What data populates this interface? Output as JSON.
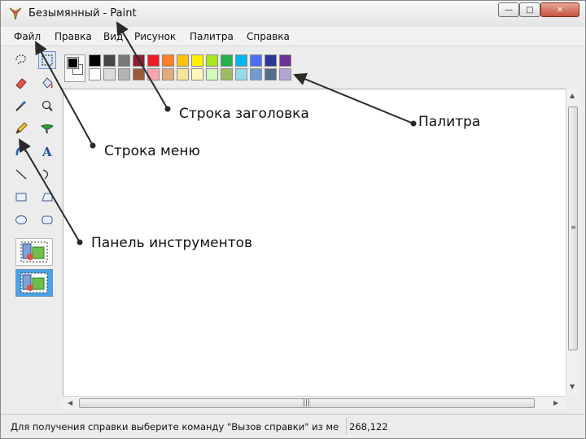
{
  "window": {
    "title": "Безымянный - Paint",
    "controls": {
      "minimize": "—",
      "maximize": "□",
      "close": "✕"
    }
  },
  "menu": {
    "items": [
      "Файл",
      "Правка",
      "Вид",
      "Рисунок",
      "Палитра",
      "Справка"
    ]
  },
  "tools": [
    "free-select-icon",
    "rect-select-icon",
    "eraser-icon",
    "fill-icon",
    "eyedropper-icon",
    "magnifier-icon",
    "pencil-icon",
    "brush-icon",
    "airbrush-icon",
    "text-icon",
    "line-icon",
    "curve-icon",
    "rectangle-icon",
    "polygon-icon",
    "ellipse-icon",
    "rounded-rect-icon"
  ],
  "palette": {
    "foreground": "#000000",
    "background": "#ffffff",
    "row1": [
      "#000000",
      "#464646",
      "#787878",
      "#8c1e2d",
      "#ec1c24",
      "#ff7f27",
      "#ffc20e",
      "#fff200",
      "#a8e61d",
      "#22b14c",
      "#00b7ef",
      "#4d6df3",
      "#2f3699",
      "#6f3198"
    ],
    "row2": [
      "#ffffff",
      "#dcdcdc",
      "#b4b4b4",
      "#9c5a3c",
      "#ffa3b1",
      "#e5aa7a",
      "#f5e49c",
      "#fff9bd",
      "#d3f9bc",
      "#9dbb61",
      "#99d9ea",
      "#709ad1",
      "#546d8e",
      "#b5a5d5"
    ]
  },
  "status": {
    "text": "Для получения справки выберите команду \"Вызов справки\" из ме",
    "coords": "268,122"
  },
  "annotations": {
    "title_bar": "Строка заголовка",
    "menu_bar": "Строка меню",
    "palette": "Палитра",
    "toolbox": "Панель инструментов"
  }
}
